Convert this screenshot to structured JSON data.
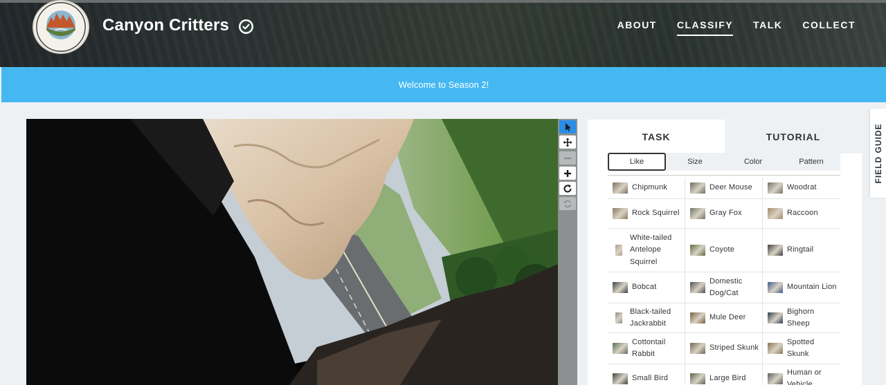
{
  "header": {
    "project_title": "Canyon Critters",
    "nav": [
      {
        "label": "ABOUT",
        "active": false
      },
      {
        "label": "CLASSIFY",
        "active": true
      },
      {
        "label": "TALK",
        "active": false
      },
      {
        "label": "COLLECT",
        "active": false
      }
    ]
  },
  "banner": {
    "text": "Welcome to Season 2!"
  },
  "viewer_tools": [
    "pointer-icon",
    "move-icon",
    "zoom-out-icon",
    "zoom-in-icon",
    "rotate-icon",
    "reset-icon"
  ],
  "task_panel": {
    "tabs": [
      {
        "label": "TASK",
        "active": true
      },
      {
        "label": "TUTORIAL",
        "active": false
      }
    ],
    "filters": [
      {
        "label": "Like",
        "active": true
      },
      {
        "label": "Size",
        "active": false
      },
      {
        "label": "Color",
        "active": false
      },
      {
        "label": "Pattern",
        "active": false
      }
    ],
    "choices": [
      {
        "label": "Chipmunk",
        "thumb": "#7c6f5a"
      },
      {
        "label": "Deer Mouse",
        "thumb": "#6a6c5d"
      },
      {
        "label": "Woodrat",
        "thumb": "#76706a"
      },
      {
        "label": "Rock Squirrel",
        "thumb": "#8b7a62"
      },
      {
        "label": "Gray Fox",
        "thumb": "#6f7462"
      },
      {
        "label": "Raccoon",
        "thumb": "#a38a66"
      },
      {
        "label": "White-tailed Antelope Squirrel",
        "thumb": "#b39a8a"
      },
      {
        "label": "Coyote",
        "thumb": "#5d6b3d"
      },
      {
        "label": "Ringtail",
        "thumb": "#3c3d3f"
      },
      {
        "label": "Bobcat",
        "thumb": "#3d4246"
      },
      {
        "label": "Domestic Dog/Cat",
        "thumb": "#4e4e4c"
      },
      {
        "label": "Mountain Lion",
        "thumb": "#3f5a8a"
      },
      {
        "label": "Black-tailed Jackrabbit",
        "thumb": "#8e8f86"
      },
      {
        "label": "Mule Deer",
        "thumb": "#7a5c3f"
      },
      {
        "label": "Bighorn Sheep",
        "thumb": "#2d3c4a"
      },
      {
        "label": "Cottontail Rabbit",
        "thumb": "#567058"
      },
      {
        "label": "Striped Skunk",
        "thumb": "#6f6552"
      },
      {
        "label": "Spotted Skunk",
        "thumb": "#8a7650"
      },
      {
        "label": "Small Bird",
        "thumb": "#404443"
      },
      {
        "label": "Large Bird",
        "thumb": "#59634e"
      },
      {
        "label": "Human or Vehicle",
        "thumb": "#5c5e5f"
      }
    ]
  },
  "field_guide": {
    "label": "FIELD GUIDE"
  }
}
